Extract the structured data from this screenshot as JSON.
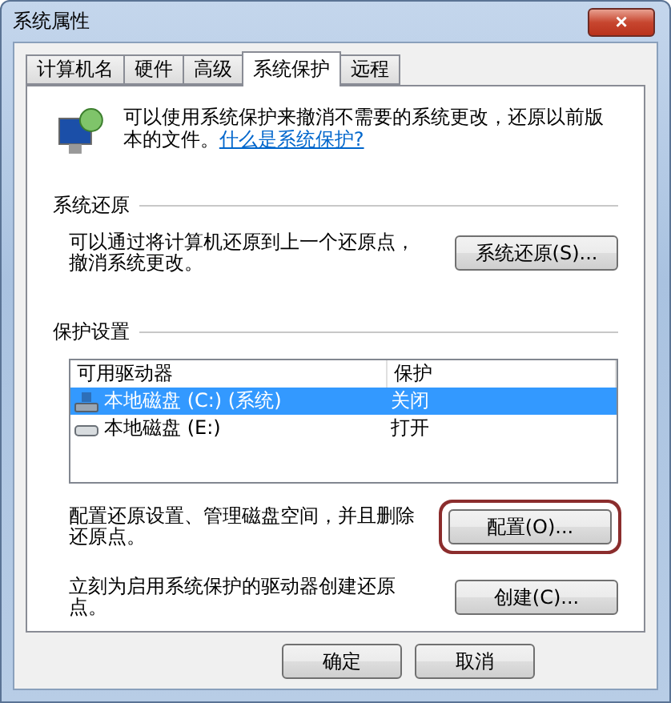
{
  "window": {
    "title": "系统属性",
    "close": "×"
  },
  "tabs": [
    {
      "label": "计算机名",
      "selected": false
    },
    {
      "label": "硬件",
      "selected": false
    },
    {
      "label": "高级",
      "selected": false
    },
    {
      "label": "系统保护",
      "selected": true
    },
    {
      "label": "远程",
      "selected": false
    }
  ],
  "intro": {
    "text": "可以使用系统保护来撤消不需要的系统更改，还原以前版本的文件。",
    "link": "什么是系统保护?"
  },
  "restore_group": {
    "title": "系统还原",
    "text": "可以通过将计算机还原到上一个还原点，撤消系统更改。",
    "button": {
      "label": "系统还原(S)...",
      "highlighted": false
    }
  },
  "protection_group": {
    "title": "保护设置",
    "columns": [
      "可用驱动器",
      "保护"
    ],
    "rows": [
      {
        "drive": "本地磁盘 (C:) (系统)",
        "protection": "关闭",
        "kind": "system",
        "selected": true
      },
      {
        "drive": "本地磁盘 (E:)",
        "protection": "打开",
        "kind": "disk",
        "selected": false
      }
    ],
    "actions": [
      {
        "text": "配置还原设置、管理磁盘空间，并且删除还原点。",
        "button": {
          "label": "配置(O)...",
          "highlighted": true
        }
      },
      {
        "text": "立刻为启用系统保护的驱动器创建还原点。",
        "button": {
          "label": "创建(C)...",
          "highlighted": false
        }
      }
    ]
  },
  "buttons": [
    "确定",
    "取消"
  ]
}
